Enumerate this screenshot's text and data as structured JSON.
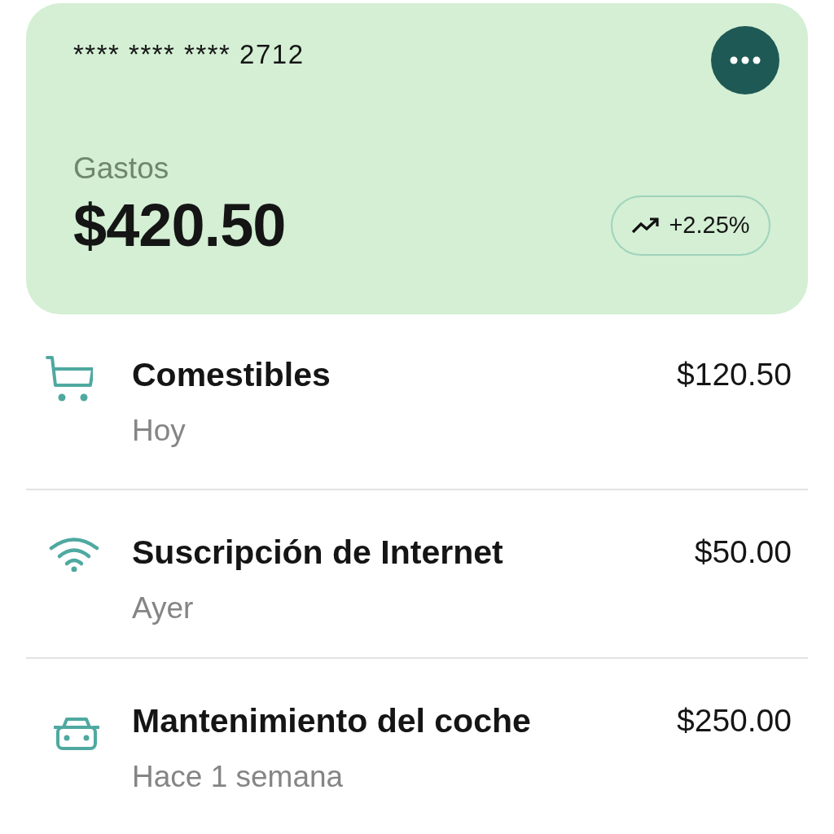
{
  "card": {
    "number": "**** **** **** 2712",
    "label": "Gastos",
    "amount": "$420.50",
    "change": "+2.25%"
  },
  "transactions": [
    {
      "kind": "cart",
      "title": "Comestibles",
      "when": "Hoy",
      "amount": "$120.50"
    },
    {
      "kind": "wifi",
      "title": "Suscripción de Internet",
      "when": "Ayer",
      "amount": "$50.00"
    },
    {
      "kind": "car",
      "title": "Mantenimiento del coche",
      "when": "Hace 1 semana",
      "amount": "$250.00"
    }
  ]
}
